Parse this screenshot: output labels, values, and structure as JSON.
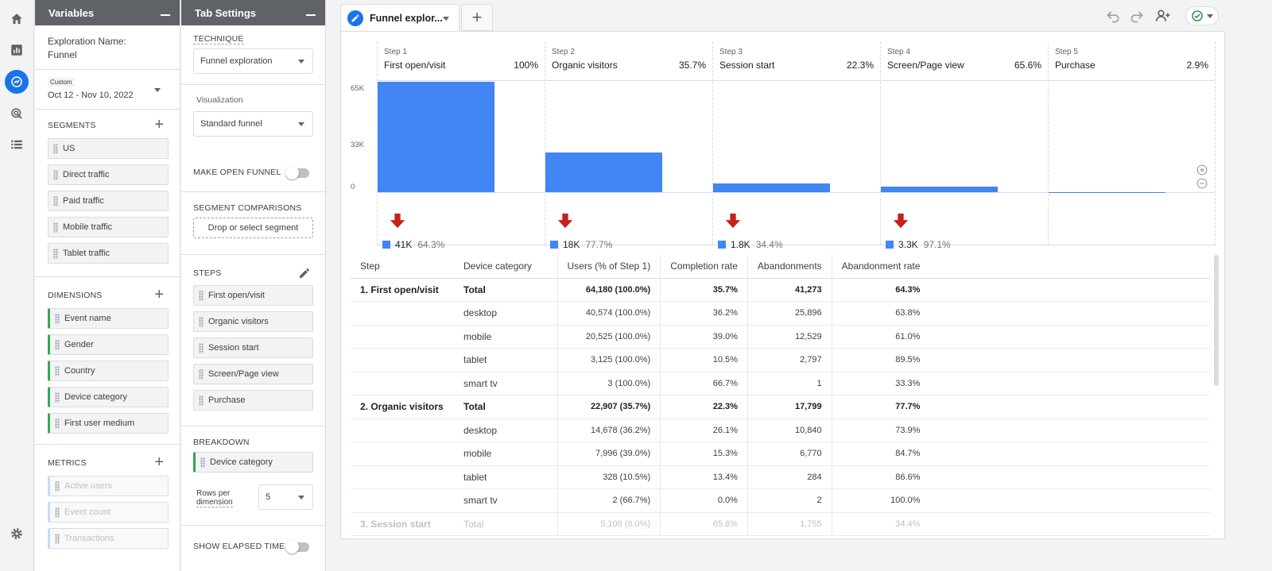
{
  "variables": {
    "panel_title": "Variables",
    "exploration_name_label": "Exploration Name:",
    "exploration_name": "Funnel",
    "date_badge": "Custom",
    "date_range": "Oct 12 - Nov 10, 2022",
    "segments_title": "SEGMENTS",
    "segments": [
      "US",
      "Direct traffic",
      "Paid traffic",
      "Mobile traffic",
      "Tablet traffic"
    ],
    "dimensions_title": "DIMENSIONS",
    "dimensions": [
      "Event name",
      "Gender",
      "Country",
      "Device category",
      "First user medium"
    ],
    "metrics_title": "METRICS",
    "metrics": [
      "Active users",
      "Event count",
      "Transactions"
    ]
  },
  "tab_settings": {
    "panel_title": "Tab Settings",
    "technique_title": "TECHNIQUE",
    "technique_value": "Funnel exploration",
    "visualization_title": "Visualization",
    "visualization_value": "Standard funnel",
    "open_funnel_label": "MAKE OPEN FUNNEL",
    "segment_comparisons_title": "SEGMENT COMPARISONS",
    "segment_drop_placeholder": "Drop or select segment",
    "steps_title": "STEPS",
    "steps": [
      "First open/visit",
      "Organic visitors",
      "Session start",
      "Screen/Page view",
      "Purchase"
    ],
    "breakdown_title": "BREAKDOWN",
    "breakdown_value": "Device category",
    "rows_per_dimension_label_1": "Rows per",
    "rows_per_dimension_label_2": "dimension",
    "rows_per_dimension_value": "5",
    "show_elapsed_time_label": "SHOW ELAPSED TIME"
  },
  "tabbar": {
    "active_tab": "Funnel explor...",
    "add_tab": "+"
  },
  "funnel": {
    "y_ticks": [
      "65K",
      "33K",
      "0"
    ],
    "steps": [
      {
        "label": "Step 1",
        "name": "First open/visit",
        "pct": "100%",
        "value": 64180,
        "drop": "41K",
        "drop_pct": "64.3%"
      },
      {
        "label": "Step 2",
        "name": "Organic visitors",
        "pct": "35.7%",
        "value": 22907,
        "drop": "18K",
        "drop_pct": "77.7%"
      },
      {
        "label": "Step 3",
        "name": "Session start",
        "pct": "22.3%",
        "value": 5108,
        "drop": "1.8K",
        "drop_pct": "34.4%"
      },
      {
        "label": "Step 4",
        "name": "Screen/Page view",
        "pct": "65.6%",
        "value": 3353,
        "drop": "3.3K",
        "drop_pct": "97.1%"
      },
      {
        "label": "Step 5",
        "name": "Purchase",
        "pct": "2.9%",
        "value": 97,
        "drop": "",
        "drop_pct": ""
      }
    ],
    "bar_color": "#4285f4",
    "drop_arrow_color": "#c5221f"
  },
  "chart_data": {
    "type": "bar",
    "categories": [
      "First open/visit",
      "Organic visitors",
      "Session start",
      "Screen/Page view",
      "Purchase"
    ],
    "values": [
      64180,
      22907,
      5108,
      3353,
      97
    ],
    "ylim": [
      0,
      65000
    ]
  },
  "table": {
    "headers": [
      "Step",
      "Device category",
      "Users (% of Step 1)",
      "Completion rate",
      "Abandonments",
      "Abandonment rate"
    ],
    "rows": [
      {
        "step": "1. First open/visit",
        "device": "Total",
        "users": "64,180 (100.0%)",
        "completion": "35.7%",
        "abandon": "41,273",
        "abandon_rate": "64.3%",
        "total": true
      },
      {
        "step": "",
        "device": "desktop",
        "users": "40,574 (100.0%)",
        "completion": "36.2%",
        "abandon": "25,896",
        "abandon_rate": "63.8%"
      },
      {
        "step": "",
        "device": "mobile",
        "users": "20,525 (100.0%)",
        "completion": "39.0%",
        "abandon": "12,529",
        "abandon_rate": "61.0%"
      },
      {
        "step": "",
        "device": "tablet",
        "users": "3,125 (100.0%)",
        "completion": "10.5%",
        "abandon": "2,797",
        "abandon_rate": "89.5%"
      },
      {
        "step": "",
        "device": "smart tv",
        "users": "3 (100.0%)",
        "completion": "66.7%",
        "abandon": "1",
        "abandon_rate": "33.3%"
      },
      {
        "step": "2. Organic visitors",
        "device": "Total",
        "users": "22,907 (35.7%)",
        "completion": "22.3%",
        "abandon": "17,799",
        "abandon_rate": "77.7%",
        "total": true
      },
      {
        "step": "",
        "device": "desktop",
        "users": "14,678 (36.2%)",
        "completion": "26.1%",
        "abandon": "10,840",
        "abandon_rate": "73.9%"
      },
      {
        "step": "",
        "device": "mobile",
        "users": "7,996 (39.0%)",
        "completion": "15.3%",
        "abandon": "6,770",
        "abandon_rate": "84.7%"
      },
      {
        "step": "",
        "device": "tablet",
        "users": "328 (10.5%)",
        "completion": "13.4%",
        "abandon": "284",
        "abandon_rate": "86.6%"
      },
      {
        "step": "",
        "device": "smart tv",
        "users": "2 (66.7%)",
        "completion": "0.0%",
        "abandon": "2",
        "abandon_rate": "100.0%"
      },
      {
        "step": "3. Session start",
        "device": "Total",
        "users": "5,108 (8.0%)",
        "completion": "65.6%",
        "abandon": "1,755",
        "abandon_rate": "34.4%",
        "total": true,
        "faded": true
      }
    ]
  }
}
